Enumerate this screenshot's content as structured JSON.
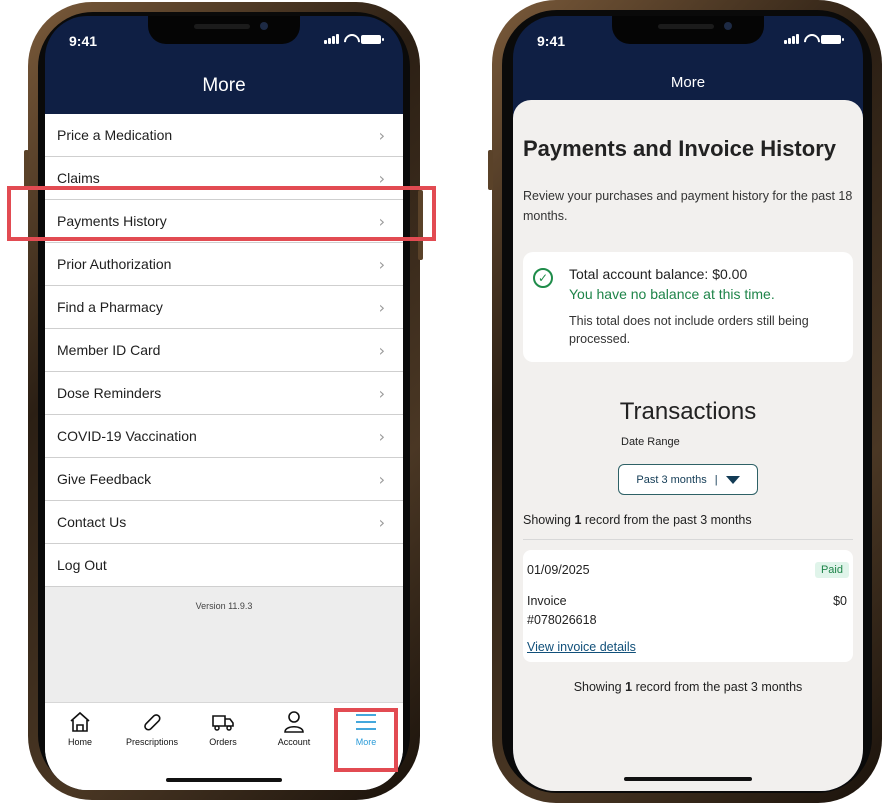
{
  "left_screen": {
    "status_time": "9:41",
    "title": "More",
    "menu_items": [
      {
        "label": "Price a Medication"
      },
      {
        "label": "Claims"
      },
      {
        "label": "Payments History"
      },
      {
        "label": "Prior Authorization"
      },
      {
        "label": "Find a Pharmacy"
      },
      {
        "label": "Member ID Card"
      },
      {
        "label": "Dose Reminders"
      },
      {
        "label": "COVID-19 Vaccination"
      },
      {
        "label": "Give Feedback"
      },
      {
        "label": "Contact Us"
      },
      {
        "label": "Log Out"
      }
    ],
    "version": "Version 11.9.3",
    "tabs": [
      {
        "label": "Home",
        "icon": "home-icon"
      },
      {
        "label": "Prescriptions",
        "icon": "pill-icon"
      },
      {
        "label": "Orders",
        "icon": "truck-icon"
      },
      {
        "label": "Account",
        "icon": "person-icon"
      },
      {
        "label": "More",
        "icon": "menu-icon",
        "active": true
      }
    ],
    "highlight_color": "#e24b52"
  },
  "right_screen": {
    "status_time": "9:41",
    "title": "More",
    "page_title": "Payments and Invoice History",
    "description": "Review your purchases and payment history for the past 18 months.",
    "balance": {
      "total": "Total account balance: $0.00",
      "status": "You have no balance at this time.",
      "note": "This total does not include orders still being processed."
    },
    "transactions_title": "Transactions",
    "date_range_label": "Date Range",
    "date_range_value": "Past 3 months",
    "showing_prefix": "Showing",
    "showing_count": "1",
    "showing_suffix": "record from the past 3 months",
    "transaction": {
      "date": "01/09/2025",
      "status": "Paid",
      "invoice_label": "Invoice",
      "invoice_number": "#078026618",
      "amount": "$0",
      "link": "View invoice details"
    }
  }
}
